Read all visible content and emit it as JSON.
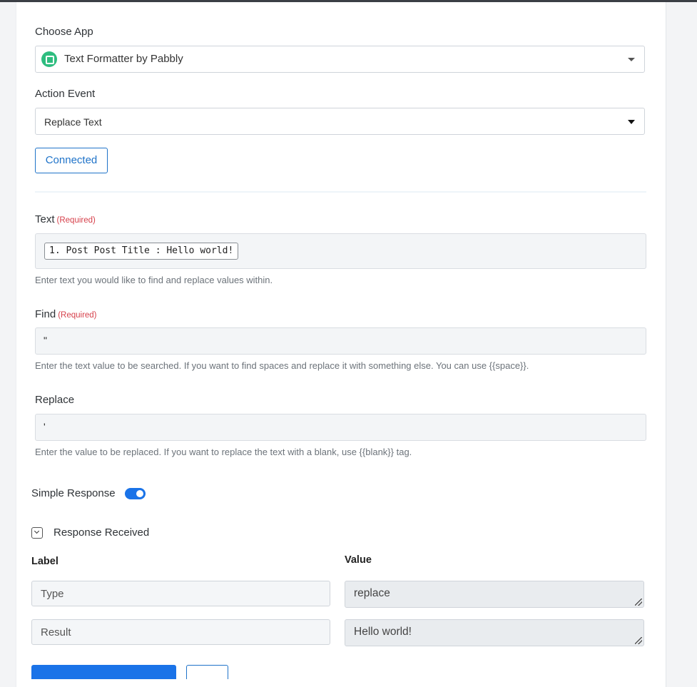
{
  "choose_app": {
    "label": "Choose App",
    "selected": "Text Formatter by Pabbly",
    "icon": "text-formatter-icon"
  },
  "action_event": {
    "label": "Action Event",
    "selected": "Replace Text"
  },
  "connection": {
    "button_label": "Connected"
  },
  "text_field": {
    "label": "Text",
    "required": "(Required)",
    "chip": "1. Post Post Title : Hello world!",
    "help": "Enter text you would like to find and replace values within."
  },
  "find_field": {
    "label": "Find",
    "required": "(Required)",
    "value": "\"",
    "help": "Enter the text value to be searched. If you want to find spaces and replace it with something else. You can use {{space}}."
  },
  "replace_field": {
    "label": "Replace",
    "value": "'",
    "help": "Enter the value to be replaced. If you want to replace the text with a blank, use {{blank}} tag."
  },
  "simple_response": {
    "label": "Simple Response",
    "enabled": true
  },
  "response": {
    "title": "Response Received",
    "label_header": "Label",
    "value_header": "Value",
    "rows": [
      {
        "label": "Type",
        "value": "replace"
      },
      {
        "label": "Result",
        "value": "Hello world!"
      }
    ]
  },
  "colors": {
    "accent": "#1a73e8",
    "required": "#d63f4a",
    "app_icon": "#2ebd7f"
  }
}
